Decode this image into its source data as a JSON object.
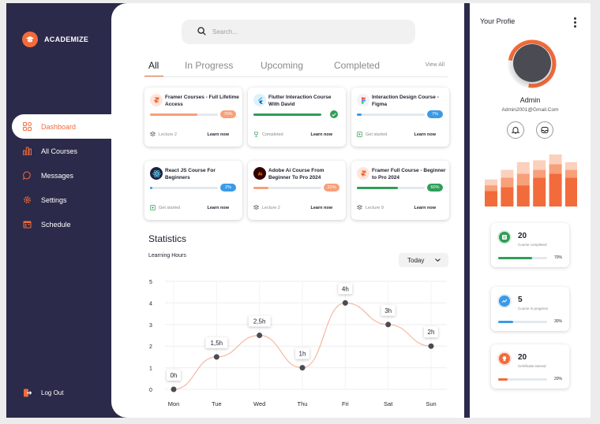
{
  "brand": {
    "name": "ACADEMIZE"
  },
  "sidebar": {
    "items": [
      {
        "label": "Dashboard",
        "icon": "grid-icon",
        "active": true
      },
      {
        "label": "All Courses",
        "icon": "bar-chart-icon"
      },
      {
        "label": "Messages",
        "icon": "chat-icon"
      },
      {
        "label": "Settings",
        "icon": "gear-icon"
      },
      {
        "label": "Schedule",
        "icon": "calendar-icon"
      }
    ],
    "logout": "Log Out"
  },
  "search": {
    "placeholder": "Search..."
  },
  "tabs": [
    "All",
    "In Progress",
    "Upcoming",
    "Completed"
  ],
  "view_all": "View All",
  "courses": [
    {
      "title": "Framer Courses - Full Lifetime Access",
      "progress": 70,
      "badge": "70%",
      "color": "#f26b3a",
      "status": "Lecture 2",
      "status_icon": "layers-icon",
      "action": "Learn now",
      "icon": "framer-icon"
    },
    {
      "title": "Flutter Interaction Course With David",
      "progress": 100,
      "badge": "",
      "color": "#2f9e57",
      "status": "Completed",
      "status_icon": "trophy-icon",
      "action": "Learn now",
      "icon": "flutter-icon"
    },
    {
      "title": "Interaction Design Course - Figma",
      "progress": 7,
      "badge": "7%",
      "color": "#3a9ae8",
      "status": "Get started",
      "status_icon": "start-icon",
      "action": "Learn now",
      "icon": "figma-icon"
    },
    {
      "title": "React JS Course For Beginners",
      "progress": 2,
      "badge": "2%",
      "color": "#3a9ae8",
      "status": "Get started",
      "status_icon": "start-icon",
      "action": "Learn now",
      "icon": "react-icon"
    },
    {
      "title": "Adobe Ai Course From Beginner To Pro 2024",
      "progress": 22,
      "badge": "22%",
      "color": "#f26b3a",
      "status": "Lecture 2",
      "status_icon": "layers-icon",
      "action": "Learn now",
      "icon": "illustrator-icon"
    },
    {
      "title": "Framer Full Course - Beginner to Pro 2024",
      "progress": 60,
      "badge": "60%",
      "color": "#2f9e57",
      "status": "Lecture 9",
      "status_icon": "layers-icon",
      "action": "Learn now",
      "icon": "framer-icon"
    }
  ],
  "statistics": {
    "title": "Statistics",
    "subtitle": "Learning Hours",
    "period": "Today"
  },
  "chart_data": {
    "type": "line",
    "categories": [
      "Mon",
      "Tue",
      "Wed",
      "Thu",
      "Fri",
      "Sat",
      "Sun"
    ],
    "values": [
      0,
      1.5,
      2.5,
      1,
      4,
      3,
      2
    ],
    "data_labels": [
      "0h",
      "1,5h",
      "2,5h",
      "1h",
      "4h",
      "3h",
      "2h"
    ],
    "y_ticks": [
      "0",
      "1",
      "2",
      "3",
      "4",
      "5"
    ],
    "ylim": [
      0,
      5
    ],
    "grid": true,
    "line_color": "#f7b7a0"
  },
  "profile": {
    "heading": "Your Profie",
    "name": "Admin",
    "email": "Admin2001@Gmail.Com",
    "ring_progress": 0.75,
    "buttons": [
      "bell-icon",
      "inbox-icon"
    ]
  },
  "profile_bars": {
    "values": [
      [
        8,
        3,
        3
      ],
      [
        10,
        5,
        4
      ],
      [
        11,
        6,
        6
      ],
      [
        15,
        4,
        5
      ],
      [
        17,
        5,
        6
      ],
      [
        15,
        4,
        4
      ]
    ],
    "colors": [
      "#f26b3a",
      "#f7a07a",
      "#fbd0bc"
    ]
  },
  "stats_cards": [
    {
      "value": "20",
      "label": "Course completed",
      "progress": 70,
      "pct": "70%",
      "color": "#2f9e57",
      "icon": "check-list-icon"
    },
    {
      "value": "5",
      "label": "Course in progress",
      "progress": 30,
      "pct": "30%",
      "color": "#3a9ae8",
      "icon": "trend-icon"
    },
    {
      "value": "20",
      "label": "Certificate earned",
      "progress": 20,
      "pct": "20%",
      "color": "#f26b3a",
      "icon": "medal-icon"
    }
  ]
}
